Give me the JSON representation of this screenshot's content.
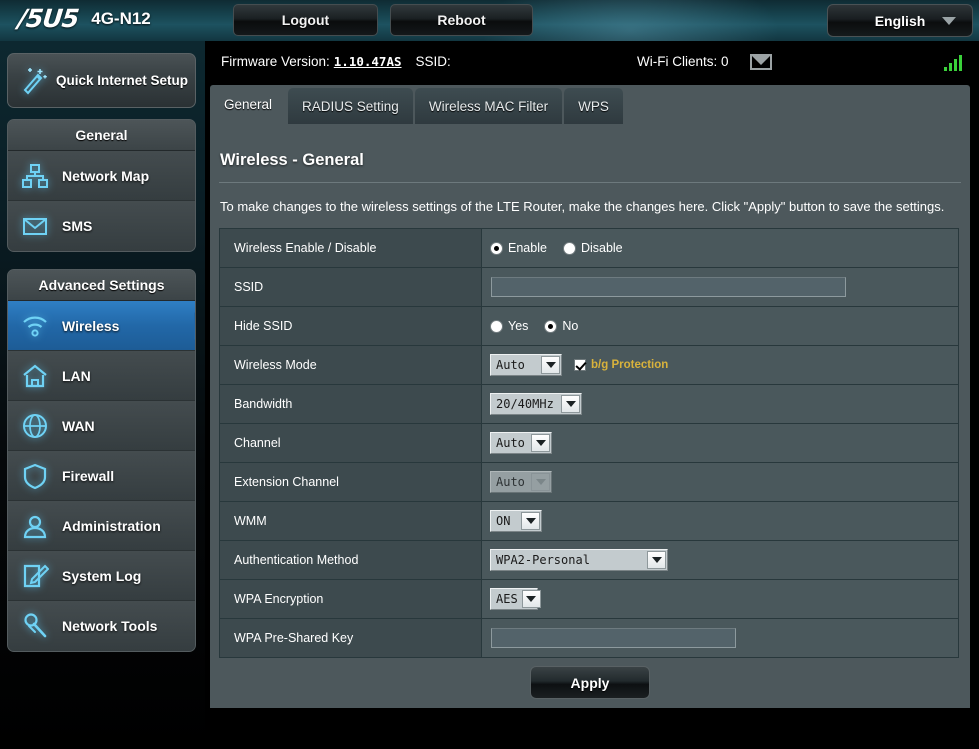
{
  "header": {
    "brand": "/5U5",
    "model": "4G-N12",
    "logout_label": "Logout",
    "reboot_label": "Reboot",
    "language": "English"
  },
  "info": {
    "firmware_label": "Firmware Version:",
    "firmware_version": "1.10.47AS",
    "ssid_label": "SSID:",
    "ssid_value": "",
    "clients_label": "Wi-Fi Clients: 0"
  },
  "sidebar": {
    "quick_setup": "Quick Internet Setup",
    "groups": [
      {
        "title": "General",
        "items": [
          {
            "label": "Network Map",
            "icon": "network-map-icon",
            "active": false
          },
          {
            "label": "SMS",
            "icon": "sms-icon",
            "active": false
          }
        ]
      },
      {
        "title": "Advanced Settings",
        "items": [
          {
            "label": "Wireless",
            "icon": "wireless-icon",
            "active": true
          },
          {
            "label": "LAN",
            "icon": "lan-icon",
            "active": false
          },
          {
            "label": "WAN",
            "icon": "wan-icon",
            "active": false
          },
          {
            "label": "Firewall",
            "icon": "firewall-icon",
            "active": false
          },
          {
            "label": "Administration",
            "icon": "administration-icon",
            "active": false
          },
          {
            "label": "System Log",
            "icon": "system-log-icon",
            "active": false
          },
          {
            "label": "Network Tools",
            "icon": "network-tools-icon",
            "active": false
          }
        ]
      }
    ]
  },
  "tabs": [
    {
      "label": "General",
      "active": true
    },
    {
      "label": "RADIUS Setting",
      "active": false
    },
    {
      "label": "Wireless MAC Filter",
      "active": false
    },
    {
      "label": "WPS",
      "active": false
    }
  ],
  "page": {
    "title": "Wireless - General",
    "description": "To make changes to the wireless settings of the LTE Router, make the changes here. Click \"Apply\" button to save the settings."
  },
  "form": {
    "wireless_enable": {
      "label": "Wireless Enable / Disable",
      "enable_label": "Enable",
      "disable_label": "Disable",
      "selected": "Enable"
    },
    "ssid": {
      "label": "SSID",
      "value": "",
      "placeholder": ""
    },
    "hide_ssid": {
      "label": "Hide SSID",
      "yes_label": "Yes",
      "no_label": "No",
      "selected": "No"
    },
    "wireless_mode": {
      "label": "Wireless Mode",
      "value": "Auto",
      "protection_label": "b/g Protection",
      "protection_checked": true
    },
    "bandwidth": {
      "label": "Bandwidth",
      "value": "20/40MHz"
    },
    "channel": {
      "label": "Channel",
      "value": "Auto"
    },
    "extension_channel": {
      "label": "Extension Channel",
      "value": "Auto",
      "disabled": true
    },
    "wmm": {
      "label": "WMM",
      "value": "ON"
    },
    "auth_method": {
      "label": "Authentication Method",
      "value": "WPA2-Personal"
    },
    "wpa_encryption": {
      "label": "WPA Encryption",
      "value": "AES"
    },
    "wpa_key": {
      "label": "WPA Pre-Shared Key",
      "value": "",
      "placeholder": ""
    }
  },
  "apply_label": "Apply",
  "colors": {
    "accent_blue": "#2268a8",
    "panel_bg": "#4d585c",
    "row_label_bg": "#3d4a4e",
    "row_value_bg": "#4a585c",
    "protection_gold": "#d8b23c",
    "signal_green": "#3ad13a"
  }
}
